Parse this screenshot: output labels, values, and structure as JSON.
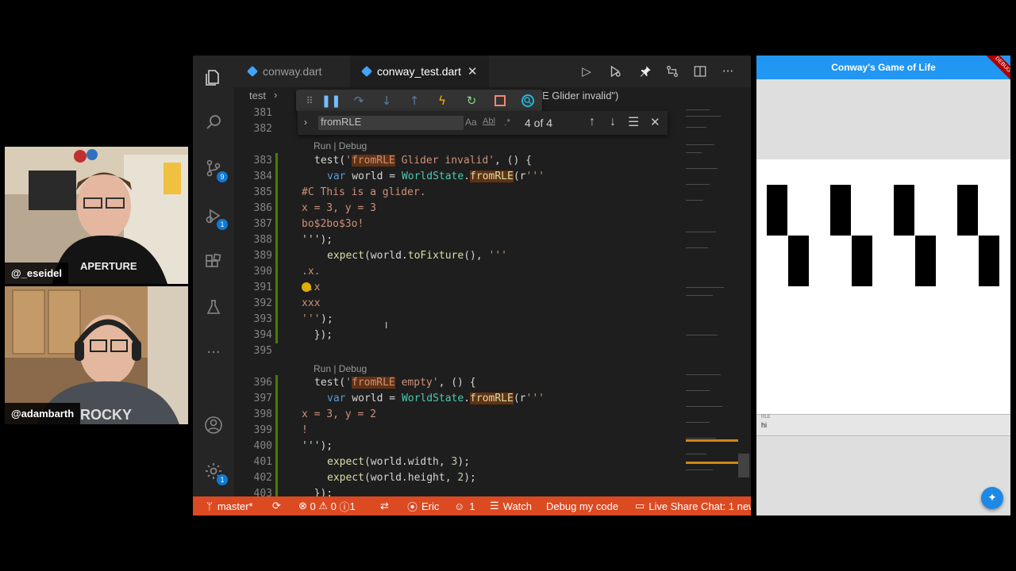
{
  "webcams": [
    {
      "name": "@_eseidel"
    },
    {
      "name": "@adambarth"
    }
  ],
  "vscode": {
    "tabs": [
      {
        "label": "conway.dart",
        "active": false
      },
      {
        "label": "conway_test.dart",
        "active": true
      }
    ],
    "breadcrumb": {
      "folder": "test",
      "tail": "E Glider invalid\")"
    },
    "find": {
      "query": "fromRLE",
      "aa": "Aa",
      "ab": "Abl",
      "count": "4 of 4"
    },
    "activity_badges": {
      "scm": "9",
      "debug": "1",
      "settings": "1"
    },
    "codelens_1": "Run | Debug",
    "codelens_2": "Run | Debug",
    "line_numbers": [
      "381",
      "382",
      "383",
      "384",
      "385",
      "386",
      "387",
      "388",
      "389",
      "390",
      "391",
      "392",
      "393",
      "394",
      "395",
      "396",
      "397",
      "398",
      "399",
      "400",
      "401",
      "402",
      "403"
    ],
    "code": {
      "l385": "#C This is a glider.",
      "l386": "x = 3, y = 3",
      "l387": "bo$2bo$3o!",
      "l388": "''');",
      "l390": ".x.",
      "l391": "..x",
      "l392": "xxx",
      "l393": "'''",
      "l393b": ");",
      "l394": "  });",
      "l398": "x = 3, y = 2",
      "l399": "!",
      "l400": "''');",
      "l403": "  });"
    },
    "statusbar": {
      "branch": "master*",
      "errors": "0",
      "warnings": "0",
      "info": "1",
      "user": "Eric",
      "share_count": "1",
      "watch": "Watch",
      "debug": "Debug my code",
      "chat": "Live Share Chat: 1 new"
    },
    "colors": {
      "statusbar": "#dc4a22",
      "editor_bg": "#1e1e1e"
    }
  },
  "app": {
    "title": "Conway's Game of Life",
    "debug_banner": "DEBUG",
    "rle_label": "RLE",
    "rle_value": "hi",
    "fab_icon": "run-icon",
    "appbar_color": "#2196f3"
  }
}
